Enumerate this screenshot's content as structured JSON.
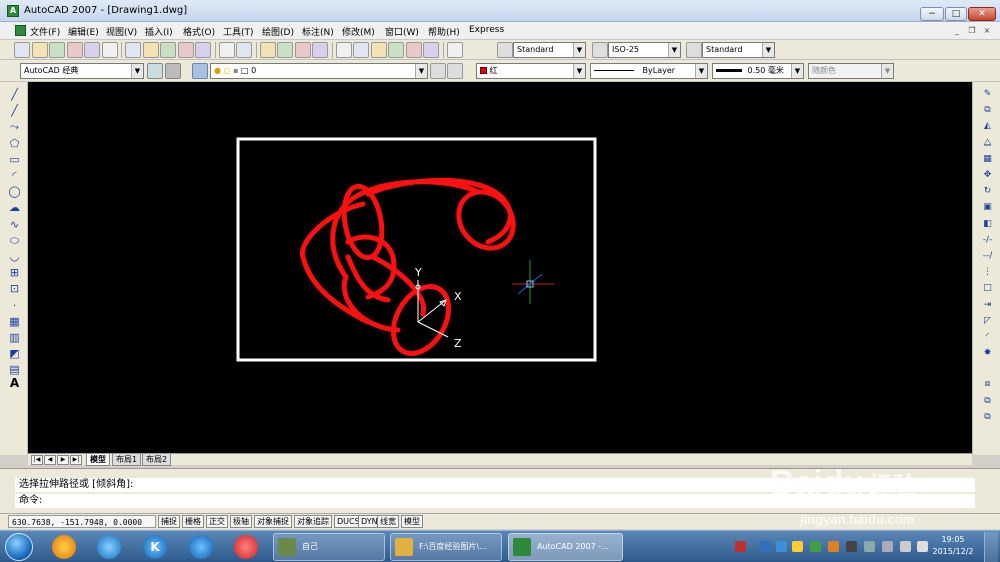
{
  "window": {
    "title": "AutoCAD 2007 - [Drawing1.dwg]",
    "min": "−",
    "max": "□",
    "close": "✕",
    "mdi_min": "_",
    "mdi_restore": "❐",
    "mdi_close": "×"
  },
  "menu": [
    "文件(F)",
    "编辑(E)",
    "视图(V)",
    "插入(I)",
    "格式(O)",
    "工具(T)",
    "绘图(D)",
    "标注(N)",
    "修改(M)",
    "窗口(W)",
    "帮助(H)",
    "Express"
  ],
  "styles_toolbar": {
    "text_style": "Standard",
    "dim_style": "ISO-25",
    "table_style": "Standard"
  },
  "layers_toolbar": {
    "workspace": "AutoCAD 经典",
    "layer": "0",
    "color": "红",
    "linetype": "ByLayer",
    "lineweight": "0.50 毫米",
    "plotstyle": "随颜色"
  },
  "icon_names": {
    "top_row_1": [
      "new-icon",
      "open-icon",
      "save-icon",
      "plot-icon",
      "plot-preview-icon",
      "publish-icon",
      "cut-icon",
      "copy-icon",
      "paste-icon",
      "match-properties-icon",
      "block-editor-icon",
      "undo-icon",
      "redo-icon",
      "pan-icon",
      "zoom-realtime-icon",
      "zoom-window-icon",
      "zoom-previous-icon",
      "properties-icon",
      "design-center-icon",
      "tool-palettes-icon",
      "sheet-set-icon",
      "markup-icon",
      "quickcalc-icon",
      "help-icon"
    ],
    "left": [
      "line-icon",
      "construction-line-icon",
      "polyline-icon",
      "polygon-icon",
      "rectangle-icon",
      "arc-icon",
      "circle-icon",
      "revision-cloud-icon",
      "spline-icon",
      "ellipse-icon",
      "ellipse-arc-icon",
      "insert-block-icon",
      "make-block-icon",
      "point-icon",
      "hatch-icon",
      "gradient-icon",
      "region-icon",
      "table-icon",
      "multiline-text-icon"
    ],
    "right": [
      "erase-icon",
      "copy-object-icon",
      "mirror-icon",
      "offset-icon",
      "array-icon",
      "move-icon",
      "rotate-icon",
      "scale-icon",
      "stretch-icon",
      "trim-icon",
      "extend-icon",
      "break-at-point-icon",
      "break-icon",
      "join-icon",
      "chamfer-icon",
      "fillet-icon",
      "explode-icon",
      "draw-order-icon",
      "bring-to-front-icon",
      "send-to-back-icon"
    ]
  },
  "drawing": {
    "ucs_labels": {
      "y": "Y",
      "x": "X",
      "z": "Z"
    },
    "stroke_color": "#ff1010",
    "frame_color": "#ffffff"
  },
  "tabs": {
    "nav": [
      "|◀",
      "◀",
      "▶",
      "▶|"
    ],
    "items": [
      "模型",
      "布局1",
      "布局2"
    ]
  },
  "command": {
    "history": "选择拉伸路径或 [倾斜角]:",
    "prompt": "命令:"
  },
  "status": {
    "coords": "630.7638, -151.7948, 0.0000",
    "buttons": [
      "捕捉",
      "栅格",
      "正交",
      "极轴",
      "对象捕捉",
      "对象追踪",
      "DUCS",
      "DYN",
      "线宽",
      "模型"
    ]
  },
  "taskbar": {
    "tasks": [
      {
        "label": "自己",
        "icon_color": "#6a8a4a"
      },
      {
        "label": "F:\\百度经验图片\\...",
        "icon_color": "#e0b040"
      },
      {
        "label": "AutoCAD 2007 -...",
        "icon_color": "#2d8a3a"
      }
    ],
    "time": "19:05",
    "date": "2015/12/2"
  },
  "watermark": {
    "brand": "Baidu",
    "chinese": "经验",
    "url": "jingyan.baidu.com"
  }
}
